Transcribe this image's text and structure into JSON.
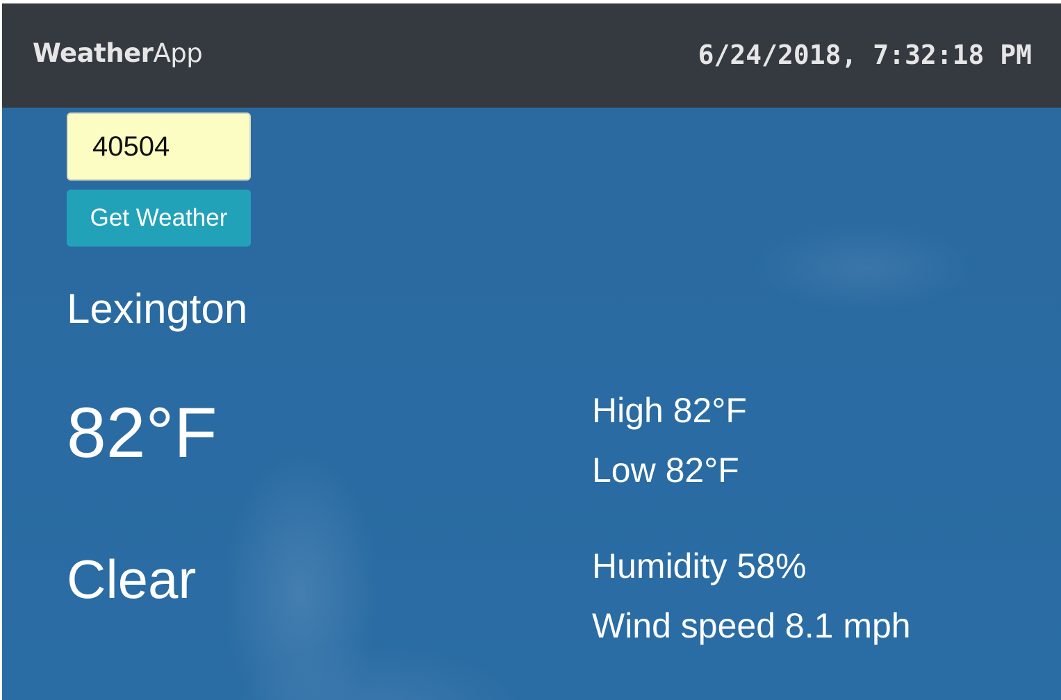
{
  "header": {
    "brand_part1": "Weather",
    "brand_part2": "App",
    "datetime": "6/24/2018, 7:32:18 PM"
  },
  "search": {
    "zip_value": "40504",
    "button_label": "Get Weather"
  },
  "weather": {
    "city": "Lexington",
    "temperature": "82°F",
    "condition": "Clear",
    "high": "High 82°F",
    "low": "Low 82°F",
    "humidity": "Humidity 58%",
    "wind": "Wind speed 8.1 mph"
  },
  "colors": {
    "navbar_bg": "#343a40",
    "sky_bg": "#2b6aa0",
    "input_bg": "#fbfdc2",
    "button_bg": "#22a2b8",
    "text_light": "#ffffff"
  }
}
